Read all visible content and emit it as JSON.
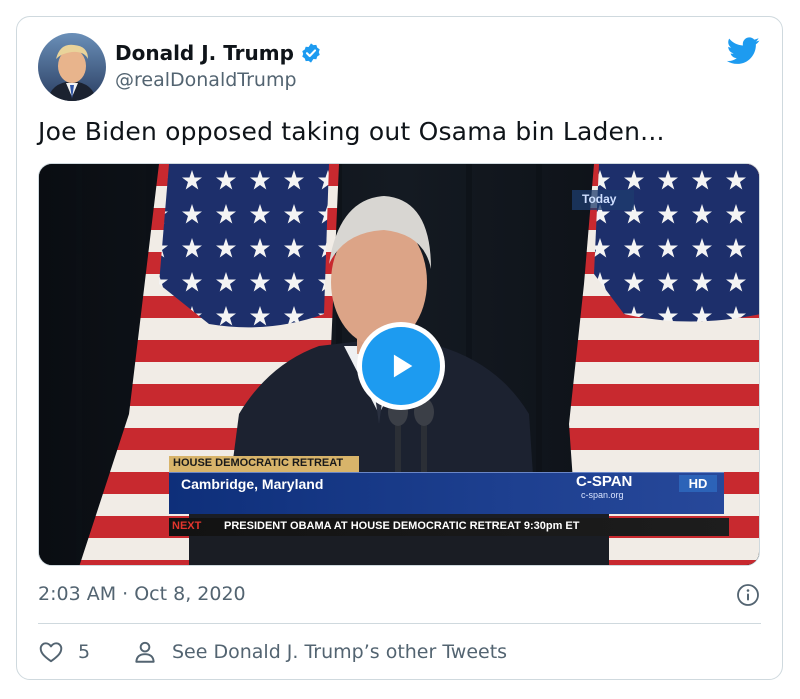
{
  "tweet": {
    "author_name": "Donald J. Trump",
    "author_handle": "@realDonaldTrump",
    "text": "Joe Biden opposed taking out Osama bin Laden...",
    "timestamp": "2:03 AM · Oct 8, 2020",
    "like_count": "5",
    "other_tweets_label": "See Donald J. Trump’s other Tweets"
  },
  "video": {
    "channel_tag": "Today",
    "chyron_title": "HOUSE DEMOCRATIC RETREAT",
    "chyron_location": "Cambridge, Maryland",
    "network_logo": "C-SPAN",
    "network_url": "c-span.org",
    "quality_badge": "HD",
    "next_label": "NEXT",
    "next_text": "PRESIDENT OBAMA AT HOUSE DEMOCRATIC RETREAT 9:30pm ET"
  },
  "icons": {
    "verified": "verified-badge-icon",
    "brand": "twitter-bird-icon",
    "play": "play-icon",
    "info": "info-icon",
    "like": "heart-icon",
    "profile": "person-icon"
  },
  "colors": {
    "accent": "#1d9bf0",
    "text": "#0f1419",
    "secondary_text": "#536471",
    "border": "#cfd9de"
  }
}
